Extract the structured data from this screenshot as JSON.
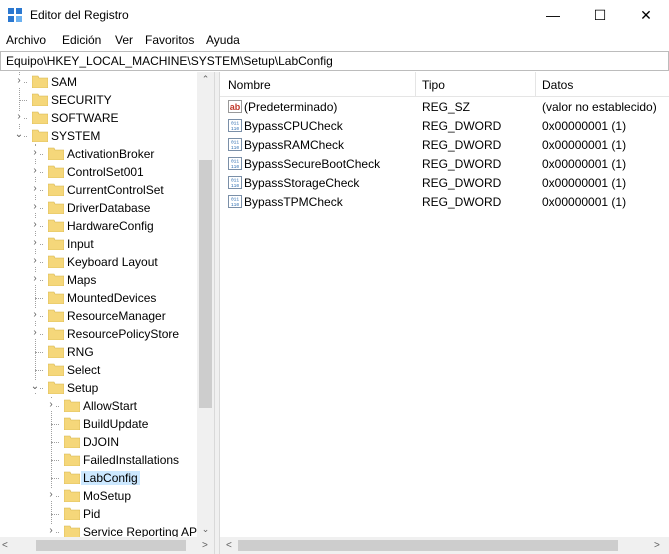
{
  "window": {
    "title": "Editor del Registro",
    "minimize_glyph": "—",
    "maximize_glyph": "☐",
    "close_glyph": "✕"
  },
  "menu": [
    "Archivo",
    "Edición",
    "Ver",
    "Favoritos",
    "Ayuda"
  ],
  "address": "Equipo\\HKEY_LOCAL_MACHINE\\SYSTEM\\Setup\\LabConfig",
  "tree": {
    "items": [
      {
        "label": "SAM",
        "expander": "›"
      },
      {
        "label": "SECURITY",
        "expander": ""
      },
      {
        "label": "SOFTWARE",
        "expander": "›"
      },
      {
        "label": "SYSTEM",
        "expander": "⌄"
      },
      {
        "label": "ActivationBroker",
        "expander": "›"
      },
      {
        "label": "ControlSet001",
        "expander": "›"
      },
      {
        "label": "CurrentControlSet",
        "expander": "›"
      },
      {
        "label": "DriverDatabase",
        "expander": "›"
      },
      {
        "label": "HardwareConfig",
        "expander": "›"
      },
      {
        "label": "Input",
        "expander": "›"
      },
      {
        "label": "Keyboard Layout",
        "expander": "›"
      },
      {
        "label": "Maps",
        "expander": "›"
      },
      {
        "label": "MountedDevices",
        "expander": ""
      },
      {
        "label": "ResourceManager",
        "expander": "›"
      },
      {
        "label": "ResourcePolicyStore",
        "expander": "›"
      },
      {
        "label": "RNG",
        "expander": ""
      },
      {
        "label": "Select",
        "expander": ""
      },
      {
        "label": "Setup",
        "expander": "⌄"
      },
      {
        "label": "AllowStart",
        "expander": "›"
      },
      {
        "label": "BuildUpdate",
        "expander": ""
      },
      {
        "label": "DJOIN",
        "expander": ""
      },
      {
        "label": "FailedInstallations",
        "expander": ""
      },
      {
        "label": "LabConfig",
        "expander": ""
      },
      {
        "label": "MoSetup",
        "expander": "›"
      },
      {
        "label": "Pid",
        "expander": ""
      },
      {
        "label": "Service Reporting API",
        "expander": "›"
      }
    ]
  },
  "list": {
    "headers": {
      "name": "Nombre",
      "type": "Tipo",
      "data": "Datos"
    },
    "rows": [
      {
        "icon": "string-value-icon",
        "name": "(Predeterminado)",
        "type": "REG_SZ",
        "data": "(valor no establecido)"
      },
      {
        "icon": "dword-value-icon",
        "name": "BypassCPUCheck",
        "type": "REG_DWORD",
        "data": "0x00000001 (1)"
      },
      {
        "icon": "dword-value-icon",
        "name": "BypassRAMCheck",
        "type": "REG_DWORD",
        "data": "0x00000001 (1)"
      },
      {
        "icon": "dword-value-icon",
        "name": "BypassSecureBootCheck",
        "type": "REG_DWORD",
        "data": "0x00000001 (1)"
      },
      {
        "icon": "dword-value-icon",
        "name": "BypassStorageCheck",
        "type": "REG_DWORD",
        "data": "0x00000001 (1)"
      },
      {
        "icon": "dword-value-icon",
        "name": "BypassTPMCheck",
        "type": "REG_DWORD",
        "data": "0x00000001 (1)"
      }
    ]
  },
  "colors": {
    "folder": "#f5d77a",
    "selection": "#cce8ff",
    "string_icon": "#c0392b",
    "dword_icon": "#2b6cb0"
  }
}
